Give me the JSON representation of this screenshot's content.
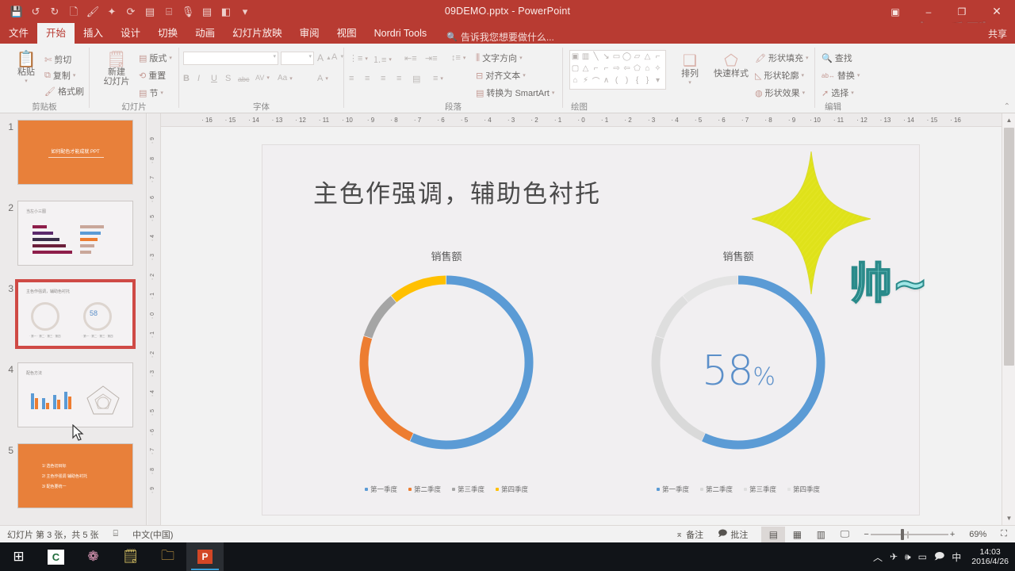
{
  "window": {
    "title": "09DEMO.pptx - PowerPoint",
    "minimize": "–",
    "restore": "❐",
    "close": "✕",
    "ribbon_display": "▣",
    "watermark_top": "知乎酷",
    "watermark_sub": "www.zhihukuu.com"
  },
  "quick_access": [
    {
      "name": "save-icon",
      "glyph": "💾"
    },
    {
      "name": "undo-icon",
      "glyph": "↺"
    },
    {
      "name": "redo-icon",
      "glyph": "↻"
    },
    {
      "name": "new-icon",
      "glyph": "🗋"
    },
    {
      "name": "brush-icon",
      "glyph": "🖌"
    },
    {
      "name": "animation-painter-icon",
      "glyph": "✦"
    },
    {
      "name": "slideshow-icon",
      "glyph": "⟳"
    },
    {
      "name": "table-icon",
      "glyph": "▤"
    },
    {
      "name": "align-icon",
      "glyph": "⌸"
    },
    {
      "name": "record-icon",
      "glyph": "🎙"
    },
    {
      "name": "notes-icon",
      "glyph": "▤"
    },
    {
      "name": "theme-icon",
      "glyph": "◧"
    },
    {
      "name": "customize-qat-icon",
      "glyph": "▾"
    }
  ],
  "tabs": [
    {
      "label": "文件",
      "active": false
    },
    {
      "label": "开始",
      "active": true
    },
    {
      "label": "插入",
      "active": false
    },
    {
      "label": "设计",
      "active": false
    },
    {
      "label": "切换",
      "active": false
    },
    {
      "label": "动画",
      "active": false
    },
    {
      "label": "幻灯片放映",
      "active": false
    },
    {
      "label": "审阅",
      "active": false
    },
    {
      "label": "视图",
      "active": false
    },
    {
      "label": "Nordri Tools",
      "active": false
    }
  ],
  "tell_me": "告诉我您想要做什么...",
  "share": "共享",
  "ribbon": {
    "groups": [
      {
        "name": "clipboard",
        "label": "剪贴板",
        "big_button": {
          "label": "粘贴",
          "icon": "paste-icon"
        },
        "items": [
          {
            "label": "剪切",
            "icon": "cut-icon"
          },
          {
            "label": "复制",
            "icon": "copy-icon"
          },
          {
            "label": "格式刷",
            "icon": "format-painter-icon"
          }
        ]
      },
      {
        "name": "slides",
        "label": "幻灯片",
        "big_button": {
          "label": "新建\n幻灯片",
          "icon": "new-slide-icon"
        },
        "items": [
          {
            "label": "版式",
            "icon": "layout-icon"
          },
          {
            "label": "重置",
            "icon": "reset-icon"
          },
          {
            "label": "节",
            "icon": "section-icon"
          }
        ]
      },
      {
        "name": "font",
        "label": "字体",
        "font_name": "",
        "font_size": "",
        "items": [
          {
            "label": "A",
            "icon": "grow-font-icon"
          },
          {
            "label": "A",
            "icon": "shrink-font-icon"
          },
          {
            "label": "",
            "icon": "clear-formatting-icon"
          },
          {
            "label": "B",
            "icon": "bold-icon"
          },
          {
            "label": "I",
            "icon": "italic-icon"
          },
          {
            "label": "U",
            "icon": "underline-icon"
          },
          {
            "label": "S",
            "icon": "shadow-icon"
          },
          {
            "label": "abc",
            "icon": "strikethrough-icon"
          },
          {
            "label": "AV",
            "icon": "char-spacing-icon"
          },
          {
            "label": "Aa",
            "icon": "change-case-icon"
          },
          {
            "label": "A",
            "icon": "font-color-icon"
          }
        ]
      },
      {
        "name": "paragraph",
        "label": "段落",
        "items": [
          {
            "label": "文字方向",
            "icon": "text-direction-icon"
          },
          {
            "label": "对齐文本",
            "icon": "align-text-icon"
          },
          {
            "label": "转换为 SmartArt",
            "icon": "smartart-icon"
          }
        ]
      },
      {
        "name": "drawing",
        "label": "绘图",
        "big_buttons": [
          {
            "label": "排列",
            "icon": "arrange-icon"
          },
          {
            "label": "快速样式",
            "icon": "quick-styles-icon"
          }
        ],
        "items": [
          {
            "label": "形状填充",
            "icon": "shape-fill-icon"
          },
          {
            "label": "形状轮廓",
            "icon": "shape-outline-icon"
          },
          {
            "label": "形状效果",
            "icon": "shape-effects-icon"
          }
        ]
      },
      {
        "name": "editing",
        "label": "编辑",
        "items": [
          {
            "label": "查找",
            "icon": "search-icon"
          },
          {
            "label": "替换",
            "icon": "replace-icon"
          },
          {
            "label": "选择",
            "icon": "select-icon"
          }
        ]
      }
    ]
  },
  "thumbnails": [
    {
      "num": "1",
      "kind": "orange-title",
      "title": "如何配色才能成就 PPT",
      "selected": false
    },
    {
      "num": "2",
      "kind": "bars",
      "title": "当左小三图",
      "selected": false
    },
    {
      "num": "3",
      "kind": "donuts",
      "title": "主色作强调，辅助色衬托",
      "selected": true
    },
    {
      "num": "4",
      "kind": "mixed",
      "title": "配色方法",
      "selected": false
    },
    {
      "num": "5",
      "kind": "orange-list",
      "title": "",
      "selected": false,
      "lines": [
        "1/ 选色切目标",
        "2/ 主色作强调  辅助色衬托",
        "3/ 配色要统一"
      ]
    }
  ],
  "rulers": {
    "horizontal": [
      "16",
      "15",
      "14",
      "13",
      "12",
      "11",
      "10",
      "9",
      "8",
      "7",
      "6",
      "5",
      "4",
      "3",
      "2",
      "1",
      "0",
      "1",
      "2",
      "3",
      "4",
      "5",
      "6",
      "7",
      "8",
      "9",
      "10",
      "11",
      "12",
      "13",
      "14",
      "15",
      "16"
    ],
    "vertical": [
      "9",
      "8",
      "7",
      "6",
      "5",
      "4",
      "3",
      "2",
      "1",
      "0",
      "1",
      "2",
      "3",
      "4",
      "5",
      "6",
      "7",
      "8",
      "9"
    ]
  },
  "slide": {
    "title": "主色作强调，辅助色衬托",
    "doodle_text": "帅~",
    "charts": [
      {
        "id": "left-donut",
        "title": "销售额",
        "legend": [
          "第一季度",
          "第二季度",
          "第三季度",
          "第四季度"
        ]
      },
      {
        "id": "right-donut",
        "title": "销售额",
        "center_value": "58",
        "center_unit": "%",
        "legend": [
          "第一季度",
          "第二季度",
          "第三季度",
          "第四季度"
        ]
      }
    ]
  },
  "chart_data": [
    {
      "type": "pie",
      "id": "left-donut",
      "title": "销售额",
      "variant": "doughnut",
      "categories": [
        "第一季度",
        "第二季度",
        "第三季度",
        "第四季度"
      ],
      "values": [
        57,
        23,
        9,
        11
      ],
      "value_unit": "%",
      "colors": [
        "#5b9bd5",
        "#ed7d31",
        "#a5a5a5",
        "#ffc000"
      ],
      "legend_position": "bottom",
      "start_angle": 0,
      "hole_ratio": 0.93
    },
    {
      "type": "pie",
      "id": "right-donut",
      "title": "销售额",
      "variant": "doughnut",
      "categories": [
        "第一季度",
        "第二季度",
        "第三季度",
        "第四季度"
      ],
      "values": [
        57,
        23,
        9,
        11
      ],
      "value_unit": "%",
      "colors": [
        "#5b9bd5",
        "#d9d9d9",
        "#dedede",
        "#e3e3e3"
      ],
      "highlight_category": "第一季度",
      "center_label": "58%",
      "legend_position": "bottom",
      "start_angle": 0,
      "hole_ratio": 0.9
    }
  ],
  "statusbar": {
    "slide_count": "幻灯片 第 3 张，共 5 张",
    "language_icon": "spellcheck-icon",
    "language": "中文(中国)",
    "notes": "备注",
    "comments": "批注",
    "views": [
      {
        "name": "normal-view",
        "glyph": "▤",
        "active": true
      },
      {
        "name": "slide-sorter-view",
        "glyph": "▦",
        "active": false
      },
      {
        "name": "reading-view",
        "glyph": "▥",
        "active": false
      },
      {
        "name": "slideshow-view",
        "glyph": "🖵",
        "active": false
      }
    ],
    "zoom_out": "−",
    "zoom_in": "+",
    "zoom_level": "69%",
    "fit_slide": "⛶"
  },
  "taskbar": {
    "items": [
      {
        "name": "start-button",
        "glyph": "⊞"
      },
      {
        "name": "app-c-icon",
        "glyph": "C"
      },
      {
        "name": "app-flower-icon",
        "glyph": "❁"
      },
      {
        "name": "app-notes-icon",
        "glyph": "🗒"
      },
      {
        "name": "file-explorer-icon",
        "glyph": "🗀"
      },
      {
        "name": "powerpoint-icon",
        "glyph": "P"
      }
    ],
    "tray": [
      {
        "name": "show-hidden-icons",
        "glyph": "︿"
      },
      {
        "name": "network-icon",
        "glyph": "✈"
      },
      {
        "name": "volume-icon",
        "glyph": "🕪"
      },
      {
        "name": "battery-icon",
        "glyph": "▭"
      },
      {
        "name": "action-center-icon",
        "glyph": "🗩"
      },
      {
        "name": "ime-icon",
        "glyph": "中"
      }
    ],
    "time": "14:03",
    "date": "2016/4/26"
  }
}
